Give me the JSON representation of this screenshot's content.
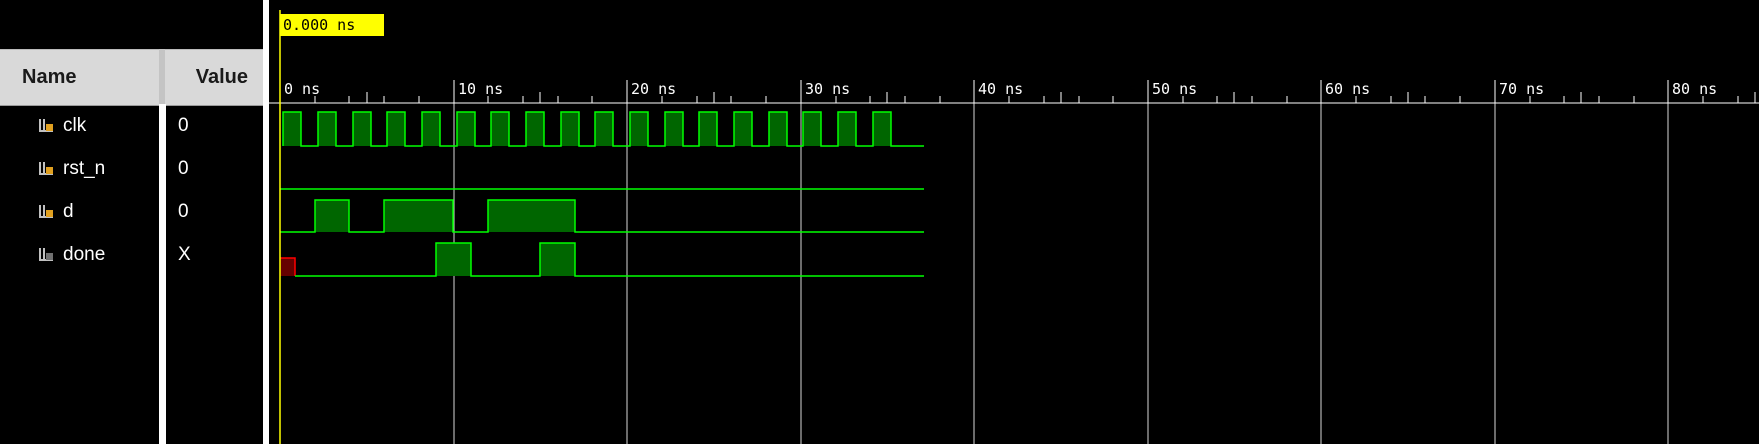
{
  "cursor": {
    "label": "0.000 ns"
  },
  "header": {
    "name": "Name",
    "value": "Value"
  },
  "signals": [
    {
      "name": "clk",
      "value": "0"
    },
    {
      "name": "rst_n",
      "value": "0"
    },
    {
      "name": "d",
      "value": "0"
    },
    {
      "name": "done",
      "value": "X"
    }
  ],
  "ruler": {
    "labels": [
      "0 ns",
      "10 ns",
      "20 ns",
      "30 ns",
      "40 ns",
      "50 ns",
      "60 ns",
      "70 ns",
      "80 ns"
    ]
  },
  "colors": {
    "wave": "#00ff00",
    "wave_fill": "#006600",
    "unknown": "#ff0000",
    "cursor": "#ffff00",
    "grid": "#ffffff"
  }
}
